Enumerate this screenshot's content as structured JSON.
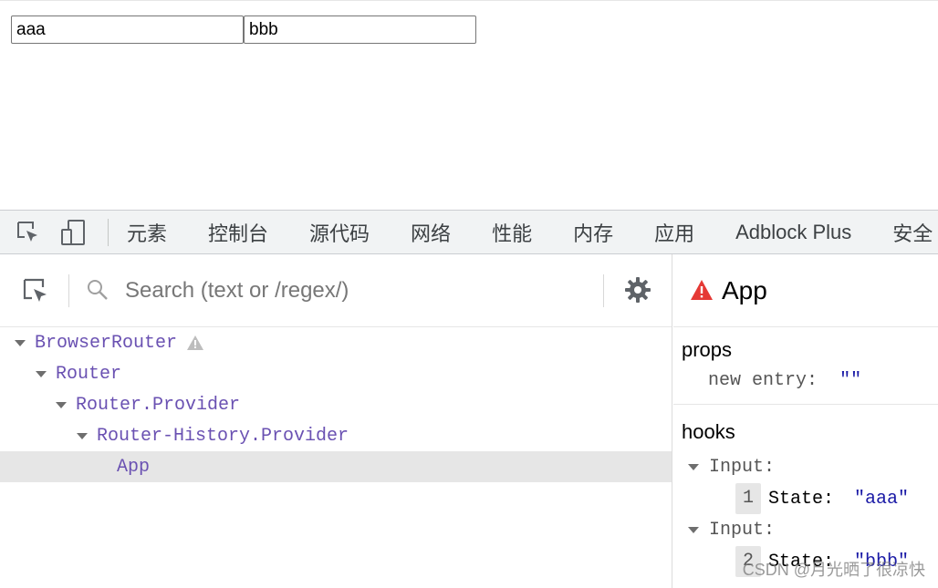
{
  "page": {
    "inputs": [
      {
        "value": "aaa"
      },
      {
        "value": "bbb"
      }
    ]
  },
  "devtools": {
    "tabs": [
      "元素",
      "控制台",
      "源代码",
      "网络",
      "性能",
      "内存",
      "应用",
      "Adblock Plus",
      "安全"
    ]
  },
  "components": {
    "search_placeholder": "Search (text or /regex/)",
    "tree": [
      {
        "name": "BrowserRouter",
        "depth": 0,
        "expanded": true,
        "warning": true,
        "selected": false
      },
      {
        "name": "Router",
        "depth": 1,
        "expanded": true,
        "warning": false,
        "selected": false
      },
      {
        "name": "Router.Provider",
        "depth": 2,
        "expanded": true,
        "warning": false,
        "selected": false
      },
      {
        "name": "Router-History.Provider",
        "depth": 3,
        "expanded": true,
        "warning": false,
        "selected": false
      },
      {
        "name": "App",
        "depth": 4,
        "expanded": false,
        "warning": false,
        "selected": true
      }
    ]
  },
  "inspector": {
    "title": "App",
    "props_label": "props",
    "props": [
      {
        "key": "new entry",
        "value": "\"\""
      }
    ],
    "hooks_label": "hooks",
    "hooks": [
      {
        "name": "Input:",
        "index": "1",
        "state_key": "State:",
        "state_value": "\"aaa\""
      },
      {
        "name": "Input:",
        "index": "2",
        "state_key": "State:",
        "state_value": "\"bbb\""
      }
    ]
  },
  "watermark": "CSDN @月光晒了很凉快",
  "colors": {
    "component_name": "#6a51b2",
    "string_value": "#1a1aa6",
    "warning_red": "#e53935",
    "selected_row": "#e6e6e6"
  },
  "icons": {
    "toolbar": [
      "inspect-element-icon",
      "device-toolbar-icon"
    ],
    "search": "search-icon",
    "settings": "gear-icon",
    "warning": "warning-icon"
  }
}
